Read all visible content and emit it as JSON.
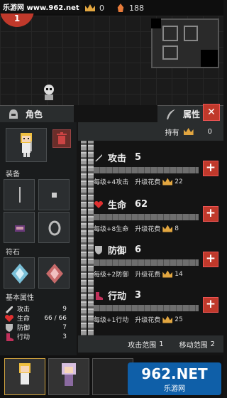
{
  "watermark": {
    "left": "乐游网 www.962.net",
    "bottom_text": "962.NET",
    "bottom_sub": "乐游网"
  },
  "hud": {
    "level": "1",
    "currency1": "0",
    "currency2": "0",
    "currency3": "188"
  },
  "character_panel": {
    "title": "角色",
    "equipment_label": "装备",
    "rune_label": "符石",
    "basic_attr_label": "基本属性",
    "basic_attrs": [
      {
        "name": "攻击",
        "value": "9",
        "icon": "sword-icon",
        "color": "#d0d0d0"
      },
      {
        "name": "生命",
        "value": "66 / 66",
        "icon": "heart-icon",
        "color": "#e03030"
      },
      {
        "name": "防御",
        "value": "7",
        "icon": "shield-icon",
        "color": "#bbbbbb"
      },
      {
        "name": "行动",
        "value": "3",
        "icon": "boot-icon",
        "color": "#c0305a"
      }
    ]
  },
  "attribute_panel": {
    "title": "属性",
    "owned_label": "持有",
    "owned_value": "0",
    "stats": [
      {
        "name": "攻击",
        "value": "5",
        "desc": "每级+4攻击",
        "cost_label": "升级花费",
        "cost": "22",
        "icon": "sword-icon"
      },
      {
        "name": "生命",
        "value": "62",
        "desc": "每级+8生命",
        "cost_label": "升级花费",
        "cost": "8",
        "icon": "heart-icon"
      },
      {
        "name": "防御",
        "value": "6",
        "desc": "每级+2防御",
        "cost_label": "升级花费",
        "cost": "14",
        "icon": "shield-icon"
      },
      {
        "name": "行动",
        "value": "3",
        "desc": "每级+1行动",
        "cost_label": "升级花费",
        "cost": "25",
        "icon": "boot-icon"
      }
    ],
    "plus_label": "+",
    "attack_range_label": "攻击范围",
    "attack_range_value": "1",
    "move_range_label": "移动范围",
    "move_range_value": "2"
  },
  "close_label": "✕",
  "colors": {
    "accent_red": "#c0392b",
    "gold": "#e2a640"
  }
}
